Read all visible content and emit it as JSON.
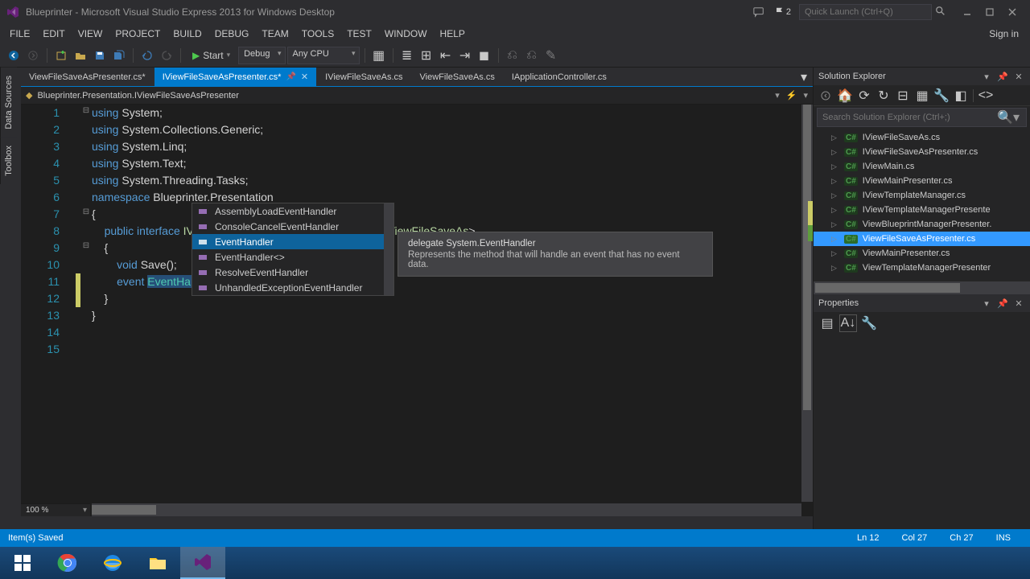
{
  "title": "Blueprinter - Microsoft Visual Studio Express 2013 for Windows Desktop",
  "title_flag_count": "2",
  "quick_launch_placeholder": "Quick Launch (Ctrl+Q)",
  "menu": [
    "FILE",
    "EDIT",
    "VIEW",
    "PROJECT",
    "BUILD",
    "DEBUG",
    "TEAM",
    "TOOLS",
    "TEST",
    "WINDOW",
    "HELP"
  ],
  "sign_in": "Sign in",
  "toolbar": {
    "start": "Start",
    "config": "Debug",
    "platform": "Any CPU"
  },
  "left_rail": [
    "Data Sources",
    "Toolbox"
  ],
  "doc_tabs": [
    {
      "label": "ViewFileSaveAsPresenter.cs*",
      "active": false
    },
    {
      "label": "IViewFileSaveAsPresenter.cs*",
      "active": true
    },
    {
      "label": "IViewFileSaveAs.cs",
      "active": false
    },
    {
      "label": "ViewFileSaveAs.cs",
      "active": false
    },
    {
      "label": "IApplicationController.cs",
      "active": false
    }
  ],
  "nav_ns": "Blueprinter.Presentation.IViewFileSaveAsPresenter",
  "code": {
    "lines": [
      {
        "n": 1,
        "html": "<span class='kw'>using</span> System;"
      },
      {
        "n": 2,
        "html": "<span class='kw'>using</span> System.Collections.Generic;"
      },
      {
        "n": 3,
        "html": "<span class='kw'>using</span> System.Linq;"
      },
      {
        "n": 4,
        "html": "<span class='kw'>using</span> System.Text;"
      },
      {
        "n": 5,
        "html": "<span class='kw'>using</span> System.Threading.Tasks;"
      },
      {
        "n": 6,
        "html": ""
      },
      {
        "n": 7,
        "html": "<span class='kw'>namespace</span> Blueprinter.Presentation"
      },
      {
        "n": 8,
        "html": "{"
      },
      {
        "n": 9,
        "html": "    <span class='kw'>public</span> <span class='kw'>interface</span> <span class='iface'>IViewFileSaveAsPresenter</span> : <span class='iface'>IPresenter</span>&lt;<span class='iface'>IViewFileSaveAs</span>&gt;"
      },
      {
        "n": 10,
        "html": "    {"
      },
      {
        "n": 11,
        "html": "        <span class='kw'>void</span> Save();"
      },
      {
        "n": 12,
        "html": "        <span class='kw'>event</span> <span class='sel'><span class='type'>EventHandler</span></span><span class='caret'></span>"
      },
      {
        "n": 13,
        "html": "    }"
      },
      {
        "n": 14,
        "html": "}"
      },
      {
        "n": 15,
        "html": ""
      }
    ]
  },
  "zoom": "100 %",
  "intellisense": {
    "items": [
      "AssemblyLoadEventHandler",
      "ConsoleCancelEventHandler",
      "EventHandler",
      "EventHandler<>",
      "ResolveEventHandler",
      "UnhandledExceptionEventHandler"
    ],
    "selected_index": 2,
    "tooltip_sig": "delegate System.EventHandler",
    "tooltip_desc": "Represents the method that will handle an event that has no event data."
  },
  "solution": {
    "title": "Solution Explorer",
    "search_placeholder": "Search Solution Explorer (Ctrl+;)",
    "items": [
      {
        "label": "IViewFileSaveAs.cs",
        "sel": false
      },
      {
        "label": "IViewFileSaveAsPresenter.cs",
        "sel": false
      },
      {
        "label": "IViewMain.cs",
        "sel": false
      },
      {
        "label": "IViewMainPresenter.cs",
        "sel": false
      },
      {
        "label": "IViewTemplateManager.cs",
        "sel": false
      },
      {
        "label": "IViewTemplateManagerPresente",
        "sel": false
      },
      {
        "label": "ViewBlueprintManagerPresenter.",
        "sel": false
      },
      {
        "label": "ViewFileSaveAsPresenter.cs",
        "sel": true
      },
      {
        "label": "ViewMainPresenter.cs",
        "sel": false
      },
      {
        "label": "ViewTemplateManagerPresenter",
        "sel": false
      }
    ]
  },
  "properties": {
    "title": "Properties"
  },
  "status": {
    "msg": "Item(s) Saved",
    "ln": "Ln 12",
    "col": "Col 27",
    "ch": "Ch 27",
    "ins": "INS"
  }
}
